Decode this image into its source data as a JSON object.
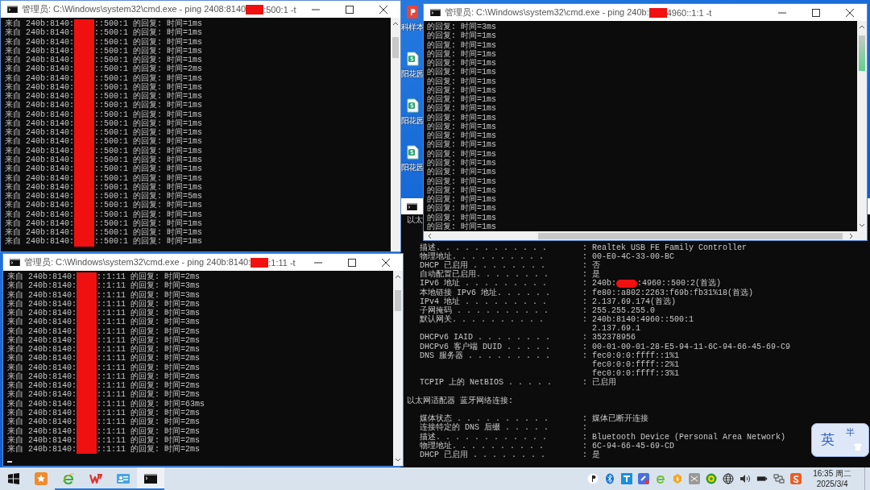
{
  "windows": [
    {
      "title": [
        "管理员: C:\\Windows\\system32\\cmd.exe - ping  2408:8140",
        ":500:1 -t"
      ],
      "lines": [
        [
          "来自 240b:8140:",
          "::500:1 的回复: 时间=1ms"
        ],
        [
          "来自 240b:8140:",
          "::500:1 的回复: 时间=1ms"
        ],
        [
          "来自 240b:8140:",
          "::500:1 的回复: 时间=1ms"
        ],
        [
          "来自 240b:8140:",
          "::500:1 的回复: 时间=1ms"
        ],
        [
          "来自 240b:8140:",
          "::500:1 的回复: 时间=1ms"
        ],
        [
          "来自 240b:8140:",
          "::500:1 的回复: 时间=2ms"
        ],
        [
          "来自 240b:8140:",
          "::500:1 的回复: 时间=1ms"
        ],
        [
          "来自 240b:8140:",
          "::500:1 的回复: 时间=1ms"
        ],
        [
          "来自 240b:8140:",
          "::500:1 的回复: 时间=1ms"
        ],
        [
          "来自 240b:8140:",
          "::500:1 的回复: 时间=1ms"
        ],
        [
          "来自 240b:8140:",
          "::500:1 的回复: 时间=1ms"
        ],
        [
          "来自 240b:8140:",
          "::500:1 的回复: 时间=1ms"
        ],
        [
          "来自 240b:8140:",
          "::500:1 的回复: 时间=1ms"
        ],
        [
          "来自 240b:8140:",
          "::500:1 的回复: 时间=1ms"
        ],
        [
          "来自 240b:8140:",
          "::500:1 的回复: 时间=1ms"
        ],
        [
          "来自 240b:8140:",
          "::500:1 的回复: 时间=1ms"
        ],
        [
          "来自 240b:8140:",
          "::500:1 的回复: 时间=1ms"
        ],
        [
          "来自 240b:8140:",
          "::500:1 的回复: 时间=1ms"
        ],
        [
          "来自 240b:8140:",
          "::500:1 的回复: 时间=1ms"
        ],
        [
          "来自 240b:8140:",
          "::500:1 的回复: 时间=5ms"
        ],
        [
          "来自 240b:8140:",
          "::500:1 的回复: 时间=1ms"
        ],
        [
          "来自 240b:8140:",
          "::500:1 的回复: 时间=1ms"
        ],
        [
          "来自 240b:8140:",
          "::500:1 的回复: 时间=1ms"
        ],
        [
          "来自 240b:8140:",
          "::500:1 的回复: 时间=1ms"
        ],
        [
          "来自 240b:8140:",
          "::500:1 的回复: 时间=1ms"
        ]
      ]
    },
    {
      "title": [
        "管理员: C:\\Windows\\system32\\cmd.exe - ping  240b:8140:",
        ":1:11 -t"
      ],
      "lines": [
        [
          "来自 240b:8140:",
          "::1:11 的回复: 时间=2ms"
        ],
        [
          "来自 240b:8140:",
          "::1:11 的回复: 时间=3ms"
        ],
        [
          "来自 240b:8140:",
          "::1:11 的回复: 时间=3ms"
        ],
        [
          "来自 240b:8140:",
          "::1:11 的回复: 时间=2ms"
        ],
        [
          "来自 240b:8140:",
          "::1:11 的回复: 时间=3ms"
        ],
        [
          "来自 240b:8140:",
          "::1:11 的回复: 时间=3ms"
        ],
        [
          "来自 240b:8140:",
          "::1:11 的回复: 时间=2ms"
        ],
        [
          "来自 240b:8140:",
          "::1:11 的回复: 时间=2ms"
        ],
        [
          "来自 240b:8140:",
          "::1:11 的回复: 时间=2ms"
        ],
        [
          "来自 240b:8140:",
          "::1:11 的回复: 时间=2ms"
        ],
        [
          "来自 240b:8140:",
          "::1:11 的回复: 时间=2ms"
        ],
        [
          "来自 240b:8140:",
          "::1:11 的回复: 时间=2ms"
        ],
        [
          "来自 240b:8140:",
          "::1:11 的回复: 时间=2ms"
        ],
        [
          "来自 240b:8140:",
          "::1:11 的回复: 时间=2ms"
        ],
        [
          "来自 240b:8140:",
          "::1:11 的回复: 时间=63ms"
        ],
        [
          "来自 240b:8140:",
          "::1:11 的回复: 时间=2ms"
        ],
        [
          "来自 240b:8140:",
          "::1:11 的回复: 时间=2ms"
        ],
        [
          "来自 240b:8140:",
          "::1:11 的回复: 时间=2ms"
        ],
        [
          "来自 240b:8140:",
          "::1:11 的回复: 时间=2ms"
        ],
        [
          "来自 240b:8140:",
          "::1:11 的回复: 时间=2ms"
        ]
      ]
    },
    {
      "title": [
        "管理员: C:\\Windows\\system32\\cmd.exe - ping  240b:",
        "4960::1:1 -t"
      ],
      "lines": [
        [
          "的回复: 时间=3ms"
        ],
        [
          "的回复: 时间=1ms"
        ],
        [
          "的回复: 时间=1ms"
        ],
        [
          "的回复: 时间=1ms"
        ],
        [
          "的回复: 时间=1ms"
        ],
        [
          "的回复: 时间=1ms"
        ],
        [
          "的回复: 时间=1ms"
        ],
        [
          "的回复: 时间=1ms"
        ],
        [
          "的回复: 时间=1ms"
        ],
        [
          "的回复: 时间=1ms"
        ],
        [
          "的回复: 时间=1ms"
        ],
        [
          "的回复: 时间=1ms"
        ],
        [
          "的回复: 时间=1ms"
        ],
        [
          "的回复: 时间=1ms"
        ],
        [
          "的回复: 时间=1ms"
        ],
        [
          "的回复: 时间=1ms"
        ],
        [
          "的回复: 时间=1ms"
        ],
        [
          "的回复: 时间=1ms"
        ],
        [
          "的回复: 时间=1ms"
        ],
        [
          "的回复: 时间=1ms"
        ],
        [
          "的回复: 时间=1ms"
        ],
        [
          "的回复: 时间=1ms"
        ],
        [
          "的回复: 时间=1ms"
        ]
      ]
    }
  ],
  "ipconfig": {
    "rows": [
      {
        "kind": "heading",
        "text": "以太"
      },
      {
        "kind": "field",
        "label": "描述. . . . . . . . . . . .",
        "value": [
          ": Realtek USB FE Family Controller"
        ]
      },
      {
        "kind": "field",
        "label": "物理地址. . . . . . . . . .",
        "value": [
          ": 00-E0-4C-33-00-BC"
        ]
      },
      {
        "kind": "field",
        "label": "DHCP 已启用 . . . . . . . .",
        "value": [
          ": 否"
        ]
      },
      {
        "kind": "field",
        "label": "自动配置已启用. . . . . . . .",
        "value": [
          ": 是"
        ]
      },
      {
        "kind": "field",
        "label": "IPv6 地址 . . . . . . . . .",
        "value": [
          ": 240b:",
          ":4960::500:2(首选)"
        ]
      },
      {
        "kind": "field",
        "label": "本地链接 IPv6 地址. . . . . .",
        "value": [
          ": fe80::a802:2263:f69b:fb31%18(首选)"
        ]
      },
      {
        "kind": "field",
        "label": "IPv4 地址 . . . . . . . . .",
        "value": [
          ": 2.137.69.174(首选)"
        ]
      },
      {
        "kind": "field",
        "label": "子网掩码 . . . . . . . . . .",
        "value": [
          ": 255.255.255.0"
        ]
      },
      {
        "kind": "field",
        "label": "默认网关. . . . . . . . . .",
        "value": [
          ": 240b:8140:4960::500:1"
        ]
      },
      {
        "kind": "field",
        "value": [
          "  2.137.69.1"
        ]
      },
      {
        "kind": "field",
        "label": "DHCPv6 IAID . . . . . . . .",
        "value": [
          ": 352378956"
        ]
      },
      {
        "kind": "field",
        "label": "DHCPv6 客户端 DUID . . . . .",
        "value": [
          ": 00-01-00-01-28-E5-94-11-6C-94-66-45-69-C9"
        ]
      },
      {
        "kind": "field",
        "label": "DNS 服务器 . . . . . . . . .",
        "value": [
          ": fec0:0:0:ffff::1%1"
        ]
      },
      {
        "kind": "field",
        "value": [
          "  fec0:0:0:ffff::2%1"
        ]
      },
      {
        "kind": "field",
        "value": [
          "  fec0:0:0:ffff::3%1"
        ]
      },
      {
        "kind": "field",
        "label": "TCPIP 上的 NetBIOS . . . . .",
        "value": [
          ": 已启用"
        ]
      },
      {
        "kind": "heading",
        "text": "以太网适配器 蓝牙网络连接:"
      },
      {
        "kind": "field",
        "label": "媒体状态 . . . . . . . . . .",
        "value": [
          ": 媒体已断开连接"
        ]
      },
      {
        "kind": "field",
        "label": "连接特定的 DNS 后缀 . . . . .",
        "value": [
          ":"
        ]
      },
      {
        "kind": "field",
        "label": "描述. . . . . . . . . . . .",
        "value": [
          ": Bluetooth Device (Personal Area Network)"
        ]
      },
      {
        "kind": "field",
        "label": "物理地址. . . . . . . . . .",
        "value": [
          ": 6C-94-66-45-69-CD"
        ]
      },
      {
        "kind": "field",
        "label": "DHCP 已启用 . . . . . . . .",
        "value": [
          ": 是"
        ]
      }
    ]
  },
  "desktop_icons": [
    {
      "label": "科样本"
    },
    {
      "label": "阳花园"
    },
    {
      "label": "阳花园"
    },
    {
      "label": "阳花园"
    }
  ],
  "ime": {
    "mode": "英",
    "width": "半"
  },
  "taskbar": {
    "apps": [
      {
        "running": false,
        "active": false
      },
      {
        "running": true,
        "active": false
      },
      {
        "running": true,
        "active": false
      },
      {
        "running": true,
        "active": false
      },
      {
        "running": true,
        "active": true
      }
    ],
    "clock": {
      "time": "16:35 周二",
      "date": "2025/3/4"
    }
  }
}
